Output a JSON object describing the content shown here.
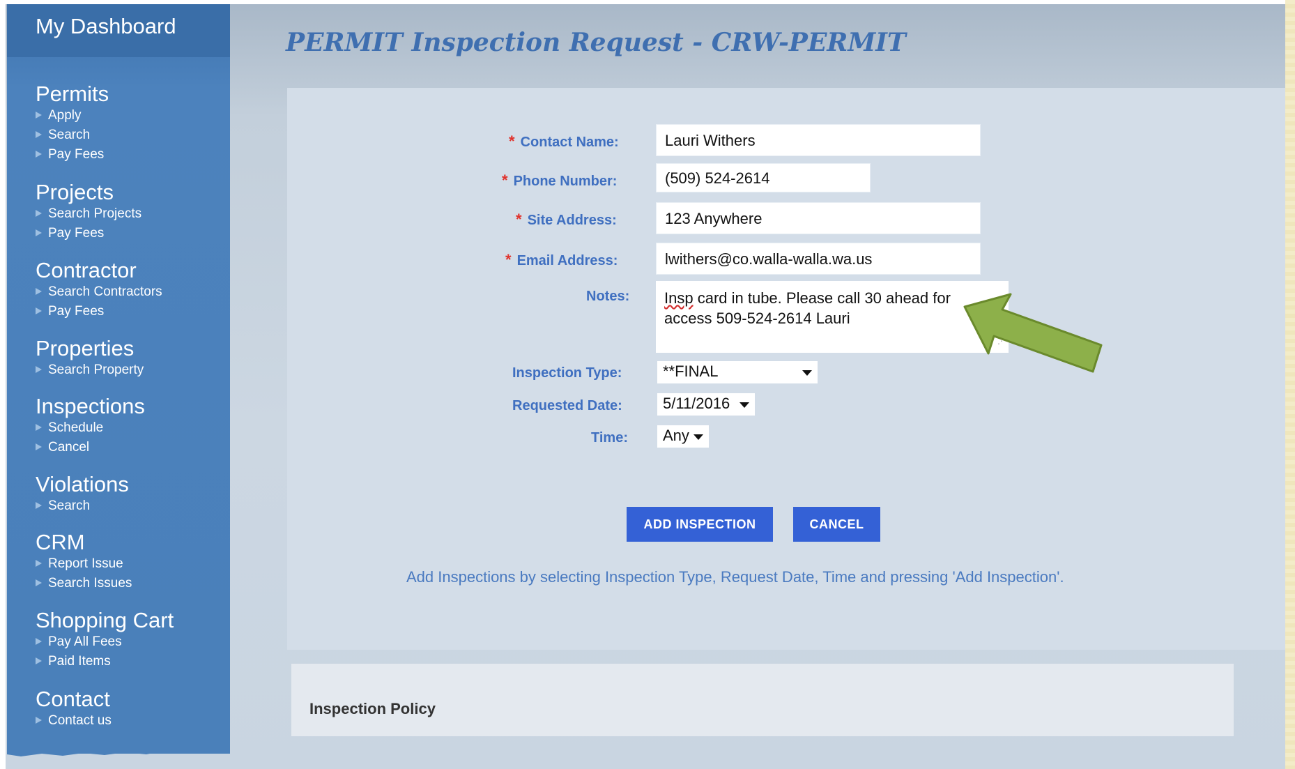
{
  "sidebar": {
    "title": "My Dashboard",
    "sections": [
      {
        "heading": "Permits",
        "items": [
          "Apply",
          "Search",
          "Pay Fees"
        ]
      },
      {
        "heading": "Projects",
        "items": [
          "Search Projects",
          "Pay Fees"
        ]
      },
      {
        "heading": "Contractor",
        "items": [
          "Search Contractors",
          "Pay Fees"
        ]
      },
      {
        "heading": "Properties",
        "items": [
          "Search Property"
        ]
      },
      {
        "heading": "Inspections",
        "items": [
          "Schedule",
          "Cancel"
        ]
      },
      {
        "heading": "Violations",
        "items": [
          "Search"
        ]
      },
      {
        "heading": "CRM",
        "items": [
          "Report Issue",
          "Search Issues"
        ]
      },
      {
        "heading": "Shopping Cart",
        "items": [
          "Pay All Fees",
          "Paid Items"
        ]
      },
      {
        "heading": "Contact",
        "items": [
          "Contact us"
        ]
      }
    ]
  },
  "page_title": "PERMIT Inspection Request - CRW-PERMIT",
  "form": {
    "required_mark": "*",
    "contact_name": {
      "label": "Contact Name:",
      "value": "Lauri Withers"
    },
    "phone_number": {
      "label": "Phone Number:",
      "value": "(509) 524-2614"
    },
    "site_address": {
      "label": "Site Address:",
      "value": "123 Anywhere"
    },
    "email_address": {
      "label": "Email Address:",
      "value": "lwithers@co.walla-walla.wa.us"
    },
    "notes": {
      "label": "Notes:",
      "value_word1": "Insp",
      "value_rest_line1": " card in tube.  Please call 30 ahead for",
      "value_line2": "access  509-524-2614  Lauri"
    },
    "inspection_type": {
      "label": "Inspection Type:",
      "value": "**FINAL"
    },
    "requested_date": {
      "label": "Requested Date:",
      "value": "5/11/2016"
    },
    "time": {
      "label": "Time:",
      "value": "Any"
    }
  },
  "buttons": {
    "add": "ADD INSPECTION",
    "cancel": "CANCEL"
  },
  "hint": "Add Inspections by selecting Inspection Type, Request Date, Time and pressing 'Add Inspection'.",
  "policy": {
    "title": "Inspection Policy"
  },
  "colors": {
    "sidebar": "#4a80ba",
    "label": "#3f6fc0",
    "button": "#3461d6",
    "arrow": "#8db04a",
    "required": "#e0322c"
  }
}
